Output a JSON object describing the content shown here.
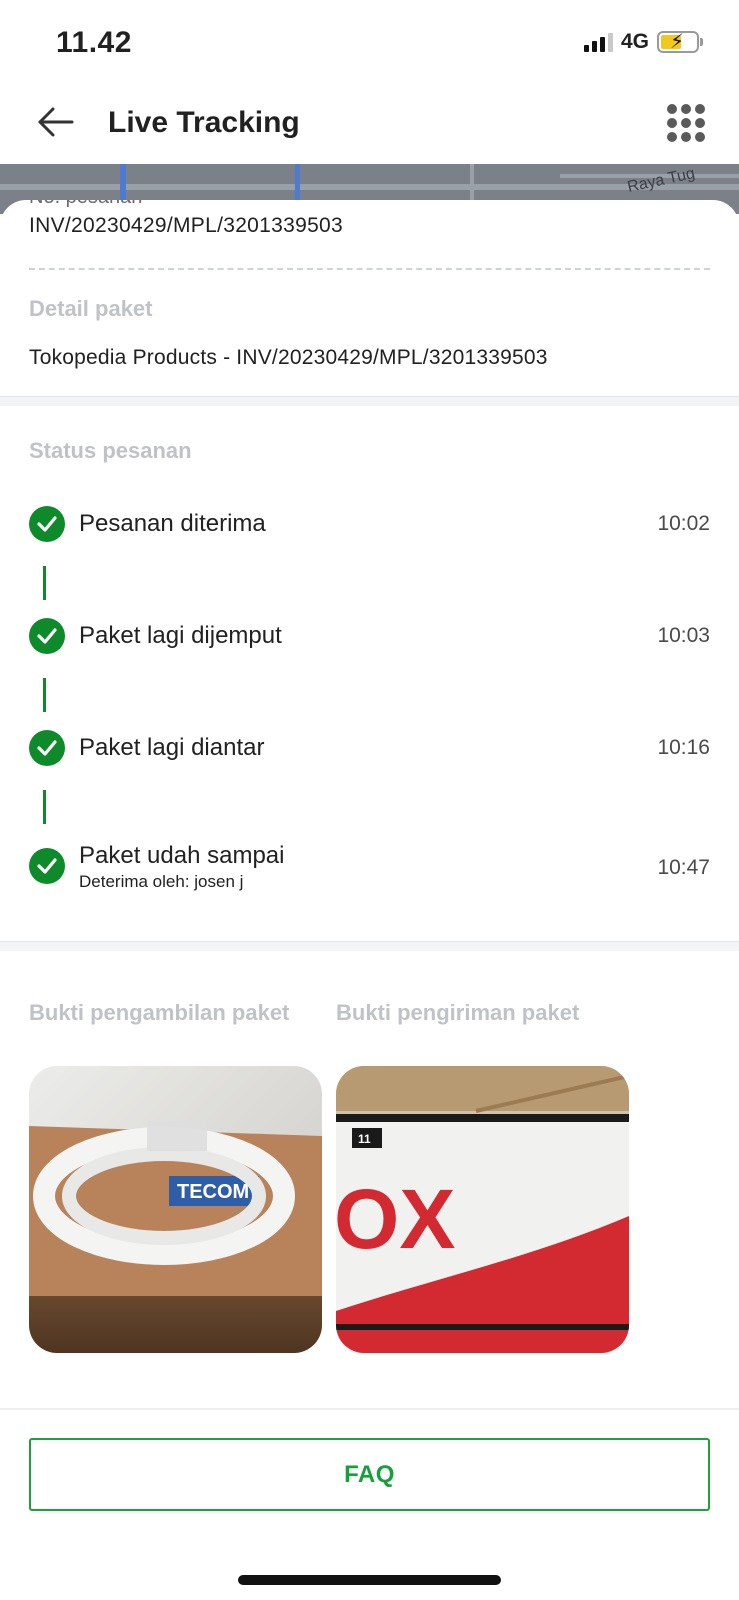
{
  "status_bar": {
    "time": "11.42",
    "network": "4G"
  },
  "header": {
    "title": "Live Tracking"
  },
  "map": {
    "street_label": "Raya Tug"
  },
  "order": {
    "number_label": "No. pesanan",
    "number_value": "INV/20230429/MPL/3201339503",
    "detail_label": "Detail paket",
    "detail_value": "Tokopedia Products - INV/20230429/MPL/3201339503"
  },
  "status": {
    "title": "Status pesanan",
    "steps": [
      {
        "label": "Pesanan diterima",
        "time": "10:02"
      },
      {
        "label": "Paket lagi dijemput",
        "time": "10:03"
      },
      {
        "label": "Paket lagi diantar",
        "time": "10:16"
      },
      {
        "label": "Paket udah sampai",
        "time": "10:47",
        "sub": "Deterima oleh: josen j"
      }
    ]
  },
  "proof": {
    "pickup_title": "Bukti pengambilan paket",
    "delivery_title": "Bukti pengiriman paket",
    "pickup_box_text": "TECOM",
    "delivery_sign_text": "OX",
    "delivery_tag_text": "11"
  },
  "footer": {
    "faq_label": "FAQ"
  },
  "colors": {
    "accent": "#0f8a2a",
    "faq_text": "#14a03a",
    "muted_label": "#bfc3c7"
  }
}
